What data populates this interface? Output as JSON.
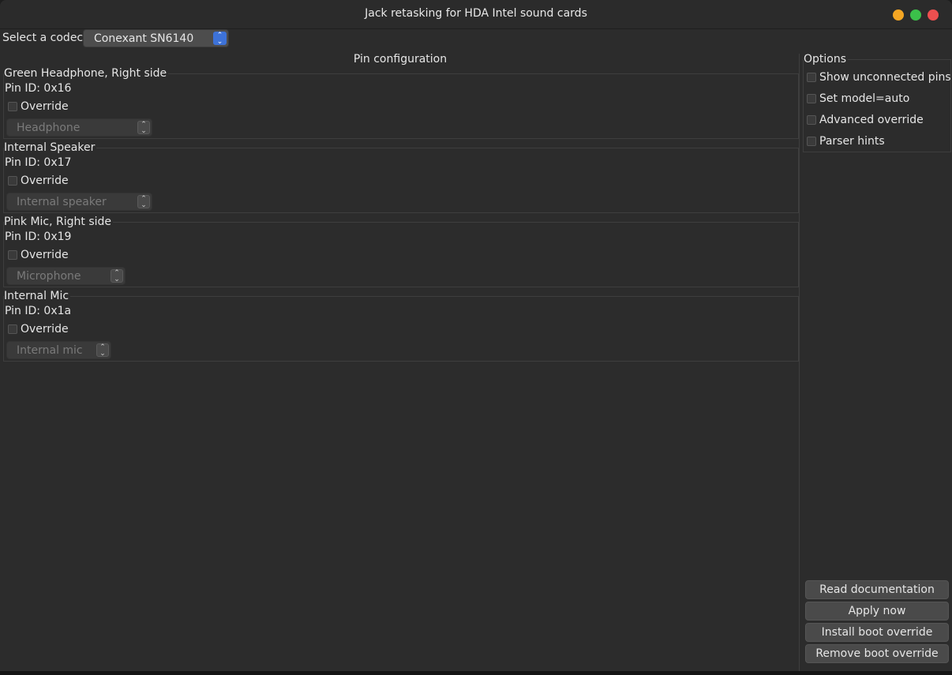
{
  "window": {
    "title": "Jack retasking for HDA Intel sound cards",
    "controls": {
      "minimize_color": "#f5a623",
      "maximize_color": "#3bc04a",
      "close_color": "#ed4f4f"
    }
  },
  "codec": {
    "label": "Select a codec:",
    "selected": "Conexant SN6140",
    "accent_color": "#3d72d8"
  },
  "pin_configuration": {
    "title": "Pin configuration",
    "pins": [
      {
        "name": "Green Headphone, Right side",
        "pin_id": "Pin ID: 0x16",
        "override_label": "Override",
        "type": "Headphone"
      },
      {
        "name": "Internal Speaker",
        "pin_id": "Pin ID: 0x17",
        "override_label": "Override",
        "type": "Internal speaker"
      },
      {
        "name": "Pink Mic, Right side",
        "pin_id": "Pin ID: 0x19",
        "override_label": "Override",
        "type": "Microphone"
      },
      {
        "name": "Internal Mic",
        "pin_id": "Pin ID: 0x1a",
        "override_label": "Override",
        "type": "Internal mic"
      }
    ]
  },
  "options": {
    "title": "Options",
    "items": [
      {
        "label": "Show unconnected pins"
      },
      {
        "label": "Set model=auto"
      },
      {
        "label": "Advanced override"
      },
      {
        "label": "Parser hints"
      }
    ]
  },
  "actions": {
    "read_documentation": "Read documentation",
    "apply_now": "Apply now",
    "install_boot_override": "Install boot override",
    "remove_boot_override": "Remove boot override"
  }
}
